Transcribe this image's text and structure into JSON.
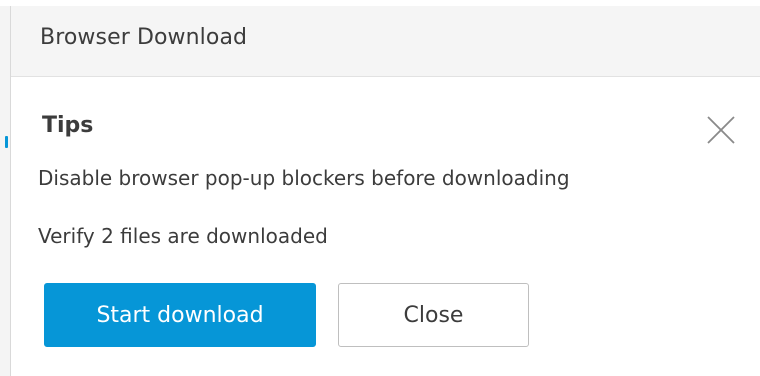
{
  "dialog": {
    "title": "Browser Download",
    "tips_heading": "Tips",
    "tips": [
      "Disable browser pop-up blockers before downloading",
      "Verify 2 files are downloaded"
    ],
    "close_icon": "close-icon",
    "buttons": {
      "start_download": "Start download",
      "close": "Close"
    }
  },
  "colors": {
    "accent": "#0696d7",
    "text": "#3c3c3c",
    "header_bg": "#f5f5f5",
    "button_border": "#bfbfbf"
  }
}
